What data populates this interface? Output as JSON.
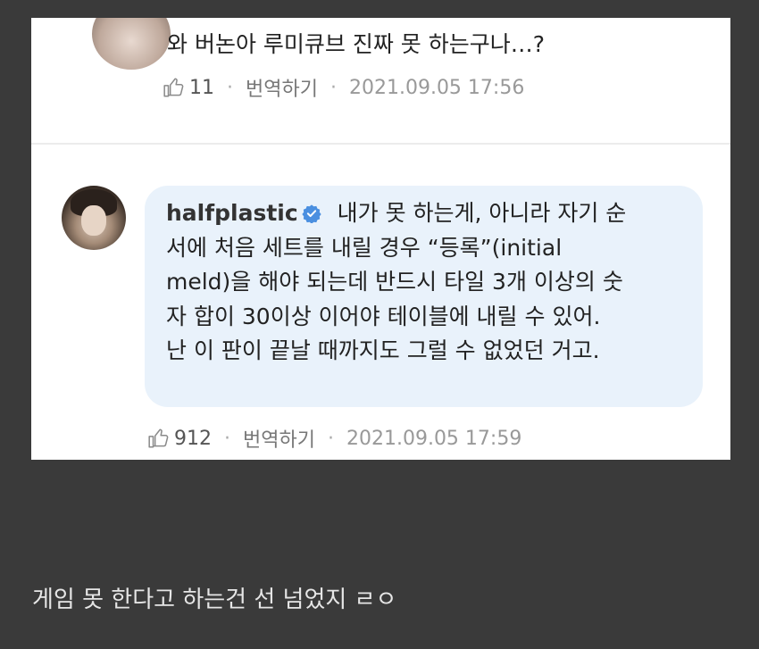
{
  "top_comment": {
    "text": "와 버논아 루미큐브 진짜 못 하는구나…?",
    "likes": "11",
    "translate_label": "번역하기",
    "timestamp": "2021.09.05 17:56"
  },
  "reply": {
    "username": "halfplastic",
    "lines": [
      " 내가 못 하는게, 아니라 자기 순",
      "서에 처음 세트를 내릴 경우 “등록”(initial",
      "meld)을 해야 되는데 반드시 타일 3개 이상의 숫",
      "자 합이 30이상 이어야 테이블에 내릴 수 있어.",
      "난 이 판이 끝날 때까지도 그럴 수 없었던 거고."
    ],
    "likes": "912",
    "translate_label": "번역하기",
    "timestamp": "2021.09.05 17:59"
  },
  "separator": "·",
  "caption": "게임 못 한다고 하는건 선 넘었지 ㄹㅇ",
  "icons": {
    "like": "thumbs-up-outline",
    "verified": "verified-badge"
  },
  "colors": {
    "page_background": "#3a3a3a",
    "bubble_background": "#e9f2fb",
    "verified_blue": "#4a8fe0"
  }
}
